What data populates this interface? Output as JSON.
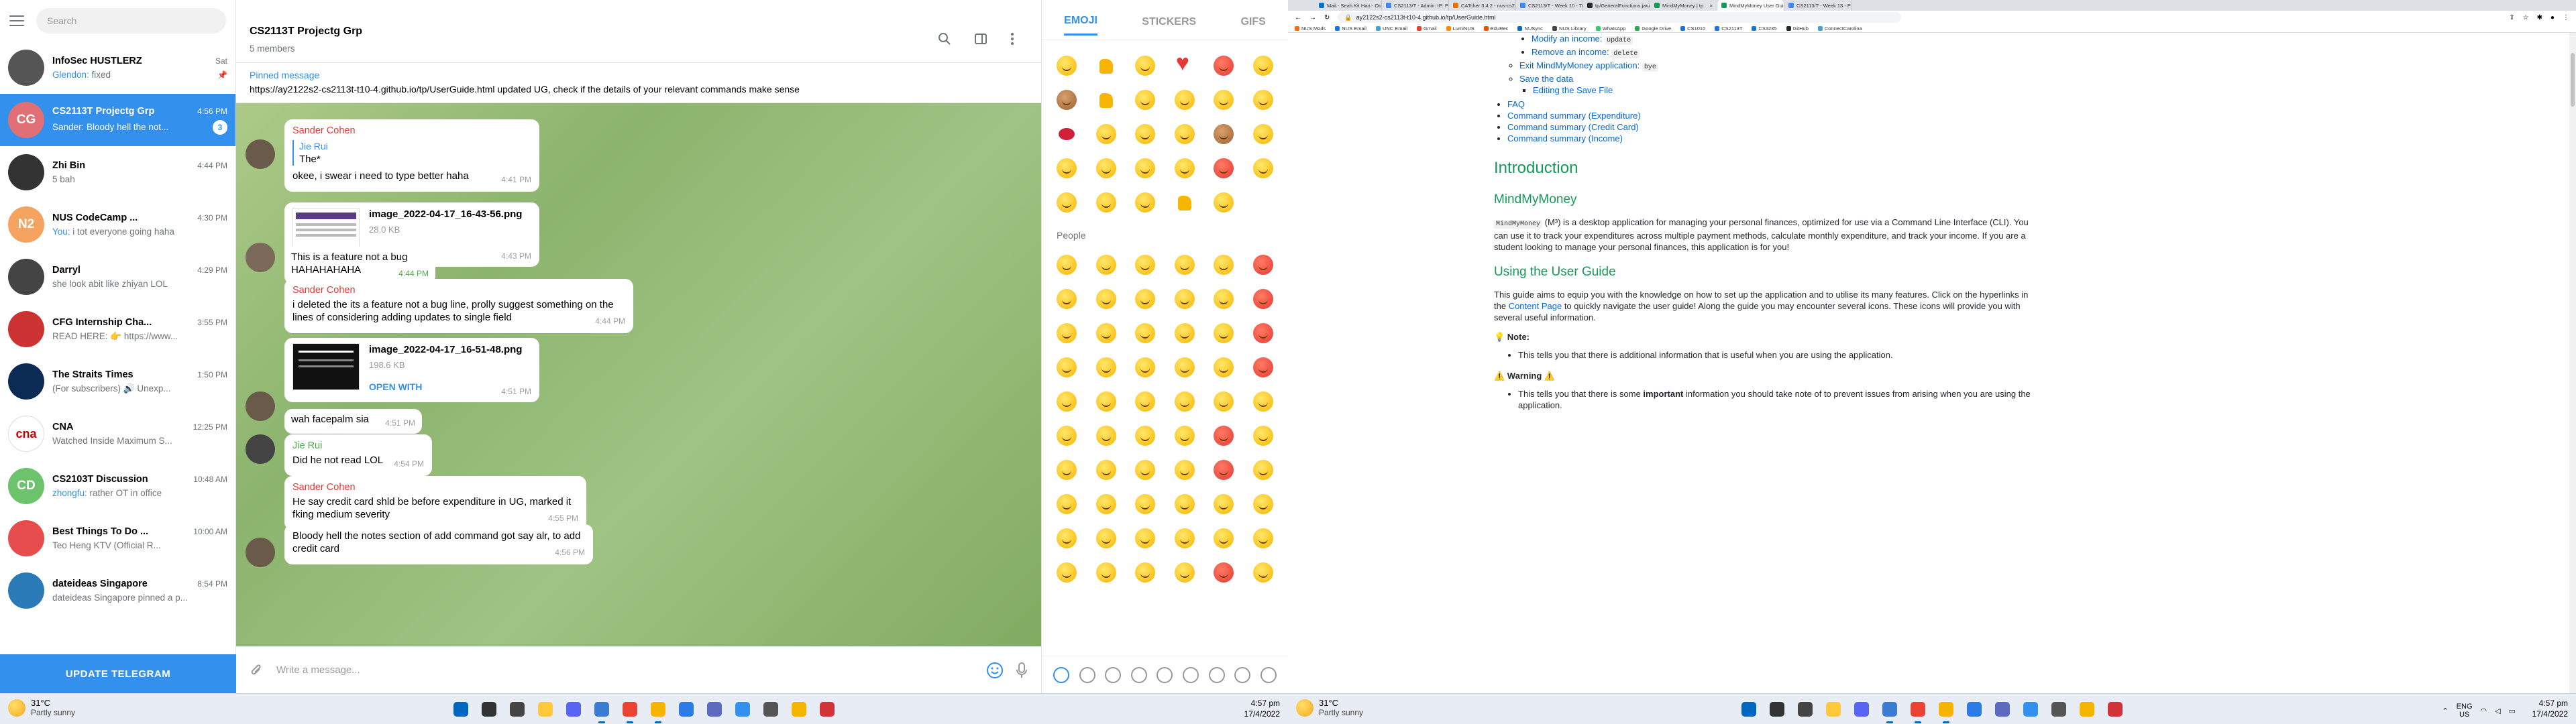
{
  "telegram": {
    "search_placeholder": "Search",
    "chats": [
      {
        "name": "InfoSec HUSTLERZ",
        "time": "Sat",
        "prev_who": "Glendon:",
        "prev": " fixed",
        "color": "#555"
      },
      {
        "name": "CS2113T Projectg Grp",
        "time": "4:56 PM",
        "prev_who": "Sander:",
        "prev": " Bloody hell the not...",
        "badge": "3",
        "initials": "CG",
        "color": "#e17076"
      },
      {
        "name": "Zhi Bin",
        "time": "4:44 PM",
        "prev_who": "",
        "prev": "5 bah",
        "color": "#333"
      },
      {
        "name": "NUS CodeCamp ...",
        "time": "4:30 PM",
        "prev_who": "You:",
        "prev": " i tot everyone going haha",
        "initials": "N2",
        "color": "#f5a361"
      },
      {
        "name": "Darryl",
        "time": "4:29 PM",
        "prev_who": "",
        "prev": "she look abit like zhiyan LOL",
        "color": "#444"
      },
      {
        "name": "CFG Internship Cha...",
        "time": "3:55 PM",
        "prev_who": "",
        "prev": "READ HERE: 👉 https://www...",
        "color": "#c33"
      },
      {
        "name": "The Straits Times",
        "time": "1:50 PM",
        "prev_who": "",
        "prev": "(For subscribers) 🔊 Unexp...",
        "color": "#0b2a54"
      },
      {
        "name": "CNA",
        "time": "12:25 PM",
        "prev_who": "",
        "prev": "Watched Inside Maximum S...",
        "color": "#fff"
      },
      {
        "name": "CS2103T Discussion",
        "time": "10:48 AM",
        "prev_who": "zhongfu:",
        "prev": " rather OT in office",
        "initials": "CD",
        "color": "#6cc36b"
      },
      {
        "name": "Best Things To Do ...",
        "time": "10:00 AM",
        "prev_who": "",
        "prev": "Teo Heng KTV (Official R...",
        "color": "#e84d4d"
      },
      {
        "name": "dateideas Singapore",
        "time": "8:54 PM",
        "prev_who": "",
        "prev": "dateideas Singapore pinned a p...",
        "color": "#2a7ab8"
      }
    ],
    "update_label": "UPDATE TELEGRAM",
    "header": {
      "title": "CS2113T Projectg Grp",
      "subtitle": "5 members"
    },
    "pinned": {
      "label": "Pinned message",
      "text": "https://ay2122s2-cs2113t-t10-4.github.io/tp/UserGuide.html  updated UG, check if the details of your relevant commands make sense"
    },
    "messages": {
      "m1_sender": "Sander Cohen",
      "m1_reply_name": "Jie Rui",
      "m1_reply_text": "The*",
      "m1_text": "okee, i swear i need to type better haha",
      "m1_time": "4:41 PM",
      "m2_file": "image_2022-04-17_16-43-56.png",
      "m2_size": "28.0 KB",
      "m2_open": "OPEN WITH",
      "m2_time": "4:43 PM",
      "m3_text": "This is a feature not a bug HAHAHAHAHA",
      "m3_time": "4:44 PM",
      "m4_sender": "Sander Cohen",
      "m4_text": "i deleted the its a feature not a bug line, prolly suggest something on the lines of considering adding updates to single field",
      "m4_time": "4:44 PM",
      "m5_file": "image_2022-04-17_16-51-48.png",
      "m5_size": "198.6 KB",
      "m5_open": "OPEN WITH",
      "m5_time": "4:51 PM",
      "m6_text": "wah facepalm sia",
      "m6_time": "4:51 PM",
      "m7_sender": "Jie Rui",
      "m7_text": "Did he not read LOL",
      "m7_time": "4:54 PM",
      "m8_sender": "Sander Cohen",
      "m8_text": "He say credit card shld be before expenditure in UG, marked it fking medium severity",
      "m8_time": "4:55 PM",
      "m9_text": "Bloody hell the notes section of add command got say alr, to add credit card",
      "m9_time": "4:56 PM"
    },
    "composer_placeholder": "Write a message...",
    "emoji_tabs": [
      "EMOJI",
      "STICKERS",
      "GIFS"
    ],
    "emoji_section": "People"
  },
  "taskbar_left": {
    "temp": "31°C",
    "cond": "Partly sunny",
    "time": "4:57 pm",
    "date": "17/4/2022"
  },
  "browser": {
    "tabs": [
      "Mail - Seah Kit Hao - Outl...",
      "CS2113/T - Admin: tP: Pos...",
      "CATcher 3.4.2 - nus-cs211...",
      "CS2113/T - Week 10 - Tuc...",
      "tp/GeneralFunctions.java ...",
      "MindMyMoney | tp",
      "MindMyMoney User Guide",
      "CS2113/T - Week 13 - Pro..."
    ],
    "url": "ay2122s2-cs2113t-t10-4.github.io/tp/UserGuide.html",
    "bookmarks": [
      "NUS Mods",
      "NUS Email",
      "UNC Email",
      "Gmail",
      "LumiNUS",
      "EduRec",
      "NUSync",
      "NUS Library",
      "WhatsApp",
      "Google Drive",
      "CS1010",
      "CS2113T",
      "CS3235",
      "GitHub",
      "ConnectCarolina"
    ]
  },
  "doc": {
    "toc_modify": "Modify an income:",
    "toc_modify_code": "update",
    "toc_remove": "Remove an income:",
    "toc_remove_code": "delete",
    "toc_exit": "Exit MindMyMoney application:",
    "toc_exit_code": "bye",
    "toc_save": "Save the data",
    "toc_editsave": "Editing the Save File",
    "toc_faq": "FAQ",
    "toc_cs_exp": "Command summary (Expenditure)",
    "toc_cs_cc": "Command summary (Credit Card)",
    "toc_cs_inc": "Command summary (Income)",
    "h_intro": "Introduction",
    "h_mmm": "MindMyMoney",
    "p_mmm_code": "MindMyMoney",
    "p_mmm": " (M³) is a desktop application for managing your personal finances, optimized for use via a Command Line Interface (CLI). You can use it to track your expenditures across multiple payment methods, calculate monthly expenditure, and track your income. If you are a student looking to manage your personal finances, this application is for you!",
    "h_using": "Using the User Guide",
    "p_using_1": "This guide aims to equip you with the knowledge on how to set up the application and to utilise its many features. Click on the hyperlinks in the ",
    "p_using_link": "Content Page",
    "p_using_2": " to quickly navigate the user guide! Along the guide you may encounter several icons. These icons will provide you with several useful information.",
    "note_title": "💡 Note:",
    "note_text": "This tells you that there is additional information that is useful when you are using the application.",
    "warn_title": "⚠️ Warning ⚠️",
    "warn_1": "This tells you that there is some ",
    "warn_bold": "important",
    "warn_2": " information you should take note of to prevent issues from arising when you are using the application."
  },
  "taskbar_right": {
    "temp": "31°C",
    "cond": "Partly sunny",
    "lang": "ENG",
    "region": "US",
    "time": "4:57 pm",
    "date": "17/4/2022"
  }
}
